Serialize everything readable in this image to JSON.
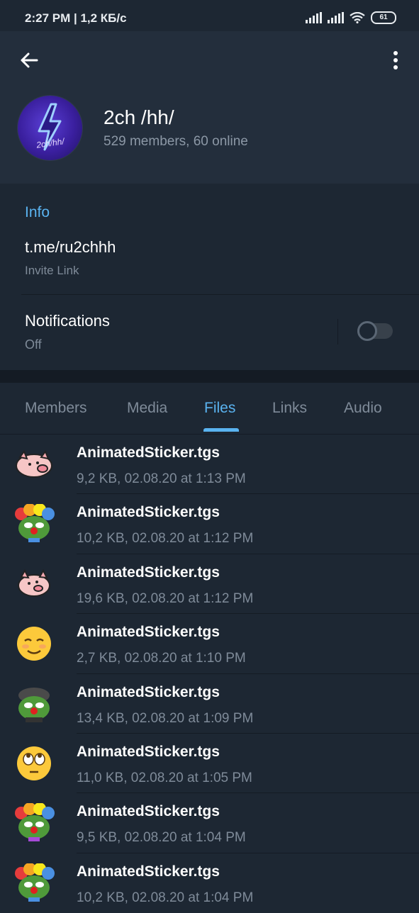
{
  "status": {
    "time": "2:27 PM | 1,2 КБ/с",
    "battery": "61"
  },
  "header": {
    "title": "2ch /hh/",
    "subtitle": "529 members, 60 online",
    "avatar_text": "2ch/hh/"
  },
  "info": {
    "heading": "Info",
    "link": "t.me/ru2chhh",
    "link_caption": "Invite Link",
    "notifications_label": "Notifications",
    "notifications_value": "Off"
  },
  "tabs": [
    {
      "label": "Members"
    },
    {
      "label": "Media"
    },
    {
      "label": "Files"
    },
    {
      "label": "Links"
    },
    {
      "label": "Audio"
    }
  ],
  "active_tab": "Files",
  "files": [
    {
      "name": "AnimatedSticker.tgs",
      "meta": "9,2 KB, 02.08.20 at 1:13 PM",
      "icon": "pig-sticker-icon"
    },
    {
      "name": "AnimatedSticker.tgs",
      "meta": "10,2 KB, 02.08.20 at 1:12 PM",
      "icon": "clown-pepe-sticker-icon"
    },
    {
      "name": "AnimatedSticker.tgs",
      "meta": "19,6 KB, 02.08.20 at 1:12 PM",
      "icon": "pig-sticker-icon"
    },
    {
      "name": "AnimatedSticker.tgs",
      "meta": "2,7 KB, 02.08.20 at 1:10 PM",
      "icon": "smiling-face-sticker-icon"
    },
    {
      "name": "AnimatedSticker.tgs",
      "meta": "13,4 KB, 02.08.20 at 1:09 PM",
      "icon": "pepe-sticker-icon"
    },
    {
      "name": "AnimatedSticker.tgs",
      "meta": "11,0 KB, 02.08.20 at 1:05 PM",
      "icon": "eye-roll-face-sticker-icon"
    },
    {
      "name": "AnimatedSticker.tgs",
      "meta": "9,5 KB, 02.08.20 at 1:04 PM",
      "icon": "clown-pepe-sticker-icon"
    },
    {
      "name": "AnimatedSticker.tgs",
      "meta": "10,2 KB, 02.08.20 at 1:04 PM",
      "icon": "clown-pepe-sticker-icon"
    }
  ],
  "colors": {
    "background": "#1d2733",
    "header_bg": "#232e3c",
    "accent": "#5ab3f0",
    "secondary_text": "#7f8b99"
  }
}
